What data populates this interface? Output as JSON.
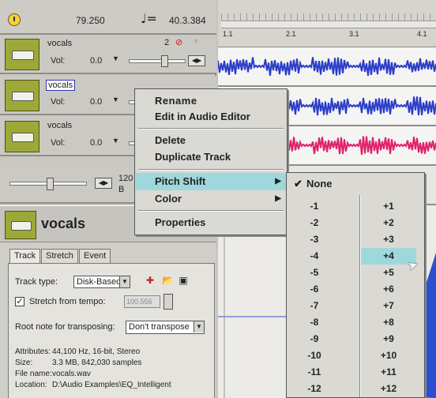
{
  "transport": {
    "tempo": "79.250",
    "note_symbol": "♩=",
    "position": "40.3.384"
  },
  "tracks": [
    {
      "name": "vocals",
      "vol_label": "Vol:",
      "vol_value": "0.0",
      "number": "2",
      "selected": false
    },
    {
      "name": "vocals",
      "vol_label": "Vol:",
      "vol_value": "0.0",
      "selected": true
    },
    {
      "name": "vocals",
      "vol_label": "Vol:",
      "vol_value": "0.0",
      "selected": false
    }
  ],
  "master": {
    "bpm_line1": "120",
    "bpm_line2": "B"
  },
  "ruler": {
    "labels": [
      "1.1",
      "2.1",
      "3.1",
      "4.1"
    ]
  },
  "detail": {
    "title": "vocals",
    "tabs": [
      "Track",
      "Stretch",
      "Event"
    ],
    "track_type_label": "Track type:",
    "track_type_value": "Disk-Based",
    "stretch_label": "Stretch from tempo:",
    "stretch_value": "100.556",
    "root_note_label": "Root note for transposing:",
    "root_note_value": "Don't transpose",
    "info": [
      {
        "key": "Attributes:",
        "value": "44,100 Hz, 16-bit, Stereo"
      },
      {
        "key": "Size:",
        "value": "3.3 MB, 842,030 samples"
      },
      {
        "key": "File name:",
        "value": "vocals.wav"
      },
      {
        "key": "Location:",
        "value": "D:\\Audio Examples\\EQ_Intelligent"
      }
    ]
  },
  "context_menu": {
    "items": [
      "Rename",
      "Edit in Audio Editor",
      "Delete",
      "Duplicate Track",
      "Pitch Shift",
      "Color",
      "Properties"
    ],
    "highlighted": "Pitch Shift"
  },
  "pitch_submenu": {
    "none_label": "None",
    "checked": "None",
    "negatives": [
      "-1",
      "-2",
      "-3",
      "-4",
      "-5",
      "-6",
      "-7",
      "-8",
      "-9",
      "-10",
      "-11",
      "-12"
    ],
    "positives": [
      "+1",
      "+2",
      "+3",
      "+4",
      "+5",
      "+6",
      "+7",
      "+8",
      "+9",
      "+10",
      "+11",
      "+12"
    ],
    "highlighted": "+4"
  },
  "colors": {
    "waveform_blue": "#2a3cc8",
    "waveform_pink": "#e0206a",
    "highlight": "#9fd8dc",
    "track_thumb": "#9ea838"
  },
  "icons": [
    "clock-icon",
    "note-icon",
    "mute-icon",
    "solo-icon",
    "move-icon",
    "open-folder-icon",
    "save-icon",
    "checkmark-icon",
    "submenu-arrow-icon",
    "cursor-icon"
  ]
}
